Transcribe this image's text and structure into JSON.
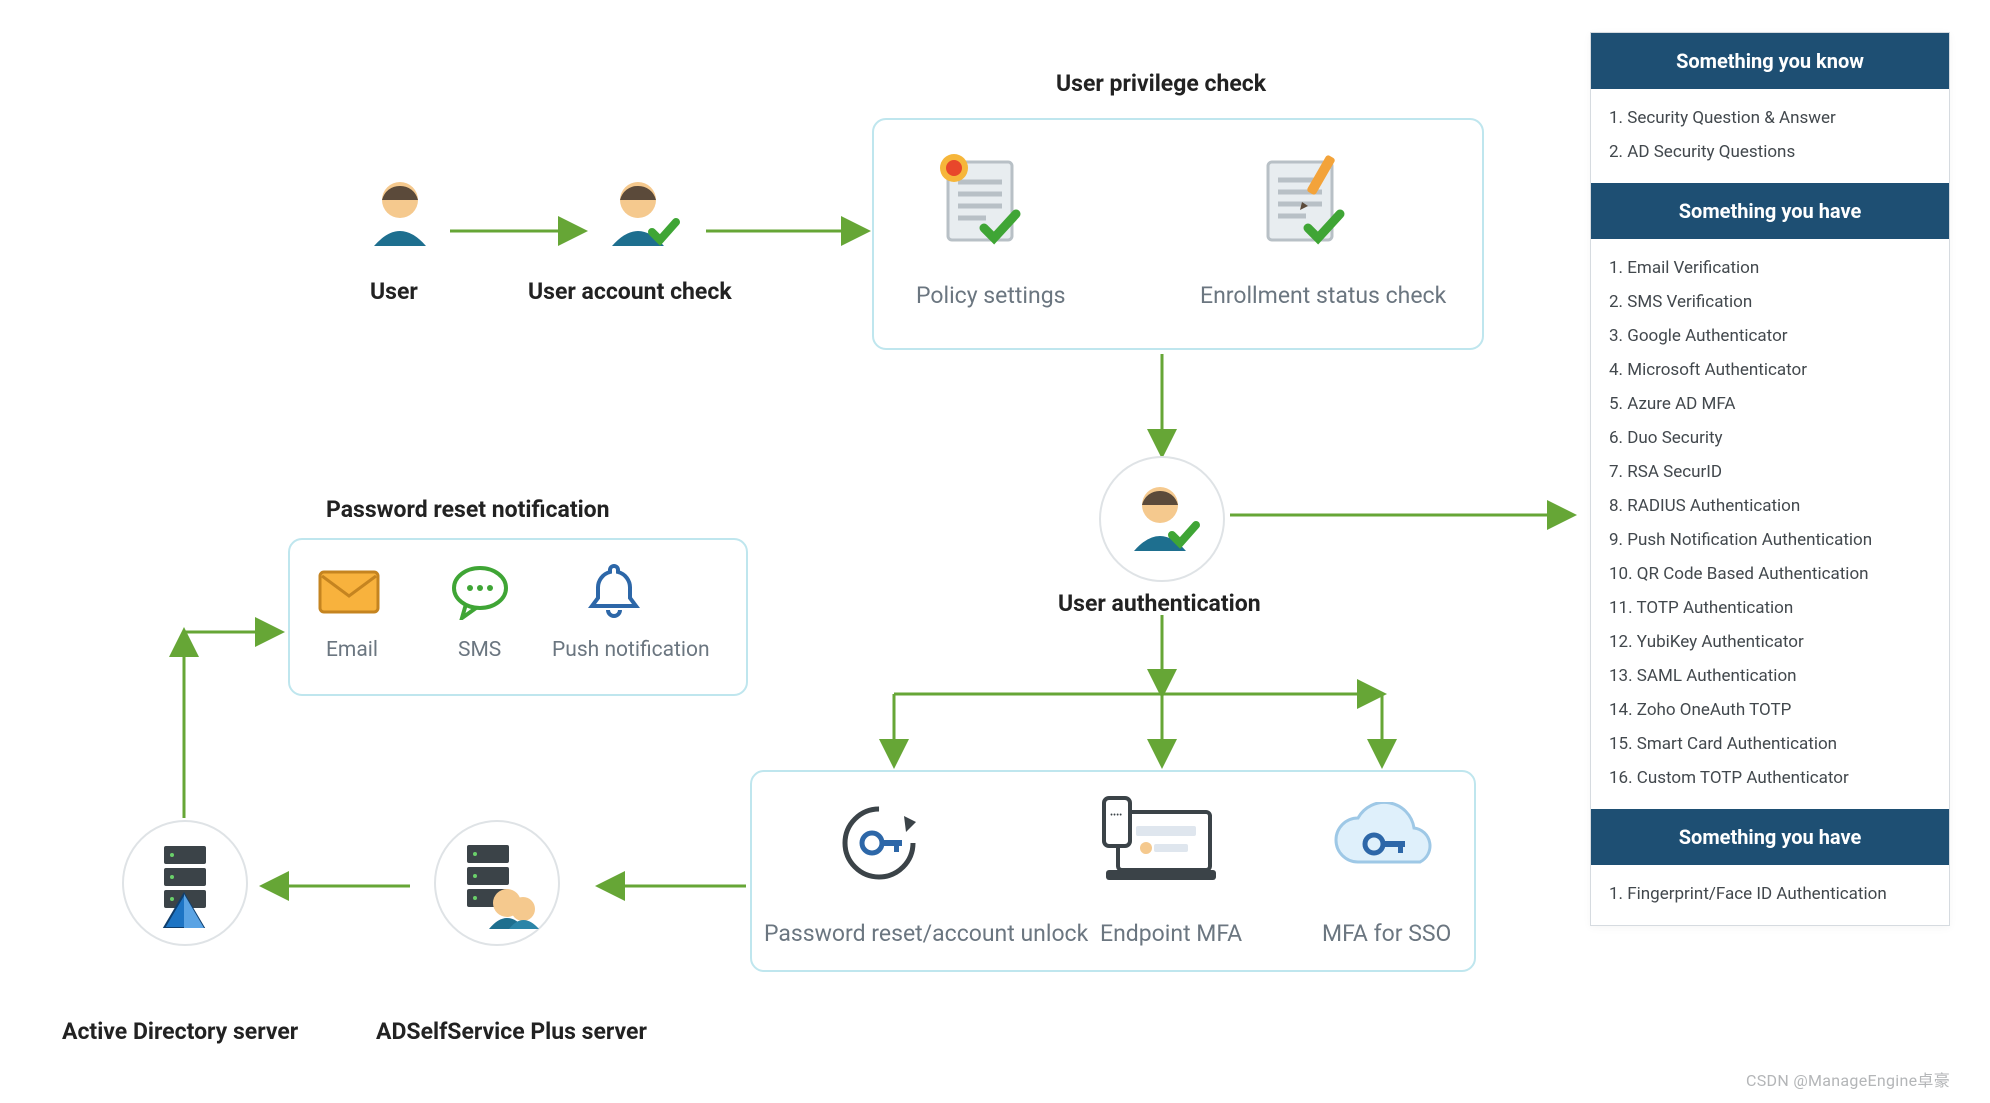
{
  "flow": {
    "user": "User",
    "account_check": "User account check",
    "privilege_check_title": "User privilege check",
    "policy_settings": "Policy settings",
    "enrollment_check": "Enrollment status check",
    "user_auth": "User authentication",
    "notify_title": "Password reset notification",
    "notify": {
      "email": "Email",
      "sms": "SMS",
      "push": "Push notification"
    },
    "ad_server": "Active Directory server",
    "adssp_server": "ADSelfService Plus server",
    "reset_unlock": "Password reset/account unlock",
    "endpoint_mfa": "Endpoint MFA",
    "mfa_sso": "MFA for SSO"
  },
  "sidebar": {
    "sections": [
      {
        "title": "Something you know",
        "items": [
          "1. Security Question & Answer",
          "2. AD Security Questions"
        ]
      },
      {
        "title": "Something you have",
        "items": [
          "1. Email Verification",
          "2. SMS Verification",
          "3. Google Authenticator",
          "4. Microsoft Authenticator",
          "5. Azure AD MFA",
          "6. Duo Security",
          "7. RSA SecurID",
          "8. RADIUS Authentication",
          "9. Push Notification Authentication",
          "10. QR Code Based Authentication",
          "11. TOTP Authentication",
          "12. YubiKey Authenticator",
          "13. SAML Authentication",
          "14. Zoho OneAuth TOTP",
          "15. Smart Card Authentication",
          "16. Custom TOTP Authenticator"
        ]
      },
      {
        "title": "Something you have",
        "items": [
          "1. Fingerprint/Face ID Authentication"
        ]
      }
    ]
  },
  "watermark": "CSDN @ManageEngine卓豪"
}
